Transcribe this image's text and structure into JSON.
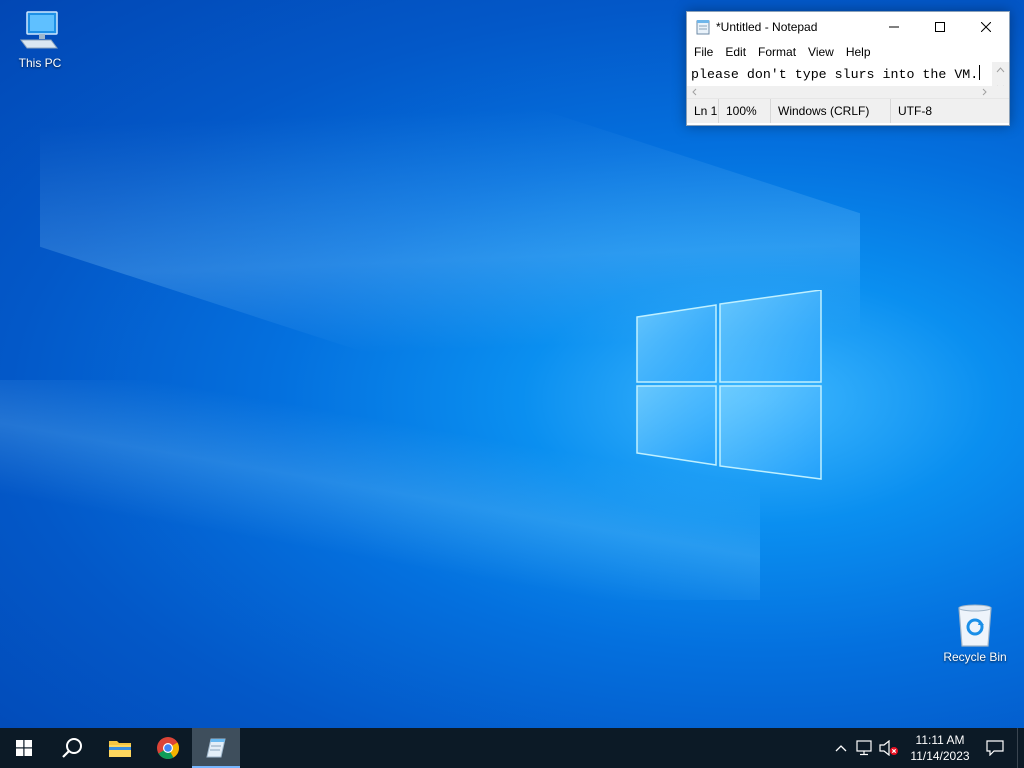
{
  "desktop": {
    "icons": [
      {
        "label": "This PC"
      },
      {
        "label": "Recycle Bin"
      }
    ]
  },
  "notepad": {
    "title": "*Untitled - Notepad",
    "menu": [
      "File",
      "Edit",
      "Format",
      "View",
      "Help"
    ],
    "content": "please don't type slurs into the VM.",
    "status": {
      "position": "Ln 1,",
      "zoom": "100%",
      "line_ending": "Windows (CRLF)",
      "encoding": "UTF-8"
    }
  },
  "taskbar": {
    "clock": {
      "time": "11:11 AM",
      "date": "11/14/2023"
    }
  },
  "colors": {
    "taskbar_bg": "#0c1a26",
    "active_indicator": "#77b6ff",
    "desktop_accent": "#0470de"
  }
}
